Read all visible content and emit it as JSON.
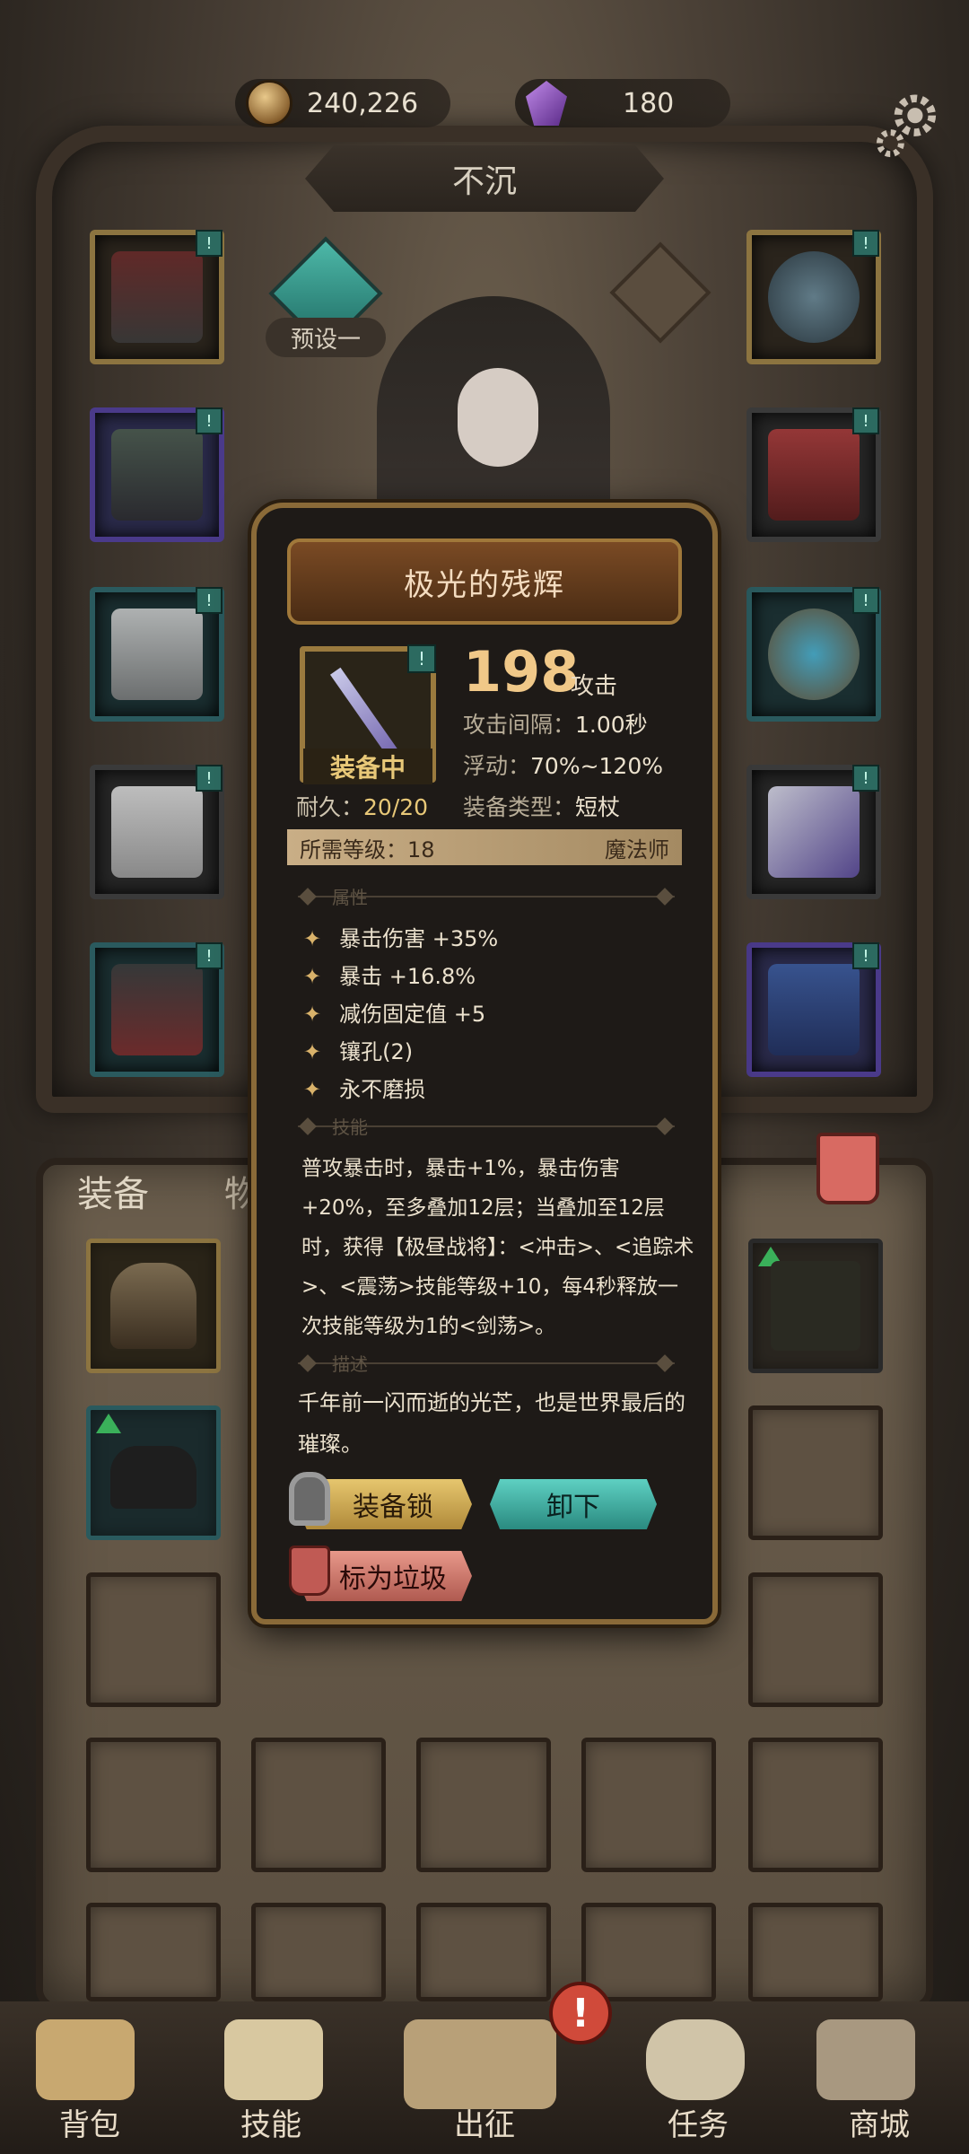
{
  "currency": {
    "gold": "240,226",
    "gems": "180"
  },
  "character_name": "不沉",
  "preset_label": "预设一",
  "tabs": {
    "equipment": "装备",
    "items": "物品"
  },
  "item": {
    "name": "极光的残辉",
    "equipped_label": "装备中",
    "attack_value": "198",
    "attack_unit": "攻击",
    "attack_interval_label": "攻击间隔：",
    "attack_interval": "1.00秒",
    "float_label": "浮动：",
    "float_range": "70%~120%",
    "equip_type_label": "装备类型：",
    "equip_type": "短杖",
    "durability_label": "耐久：",
    "durability": "20/20",
    "required_level_label": "所需等级：",
    "required_level": "18",
    "class": "魔法师",
    "attributes_title": "属性",
    "attributes": [
      "暴击伤害 +35%",
      "暴击 +16.8%",
      "减伤固定值 +5",
      "镶孔(2)",
      "永不磨损"
    ],
    "skill_title": "技能",
    "skill_text": "普攻暴击时，暴击+1%，暴击伤害+20%，至多叠加12层；当叠加至12层时，获得【极昼战将】：<冲击>、<追踪术>、<震荡>技能等级+10，每4秒释放一次技能等级为1的<剑荡>。",
    "description_title": "描述",
    "description": "千年前一闪而逝的光芒，也是世界最后的璀璨。",
    "buttons": {
      "lock": "装备锁",
      "unequip": "卸下",
      "mark_junk": "标为垃圾"
    }
  },
  "nav": [
    "背包",
    "技能",
    "出征",
    "任务",
    "商城"
  ],
  "colors": {
    "accent_gold": "#e8c878",
    "teal": "#5ed0c2",
    "alert": "#d04a3a"
  }
}
